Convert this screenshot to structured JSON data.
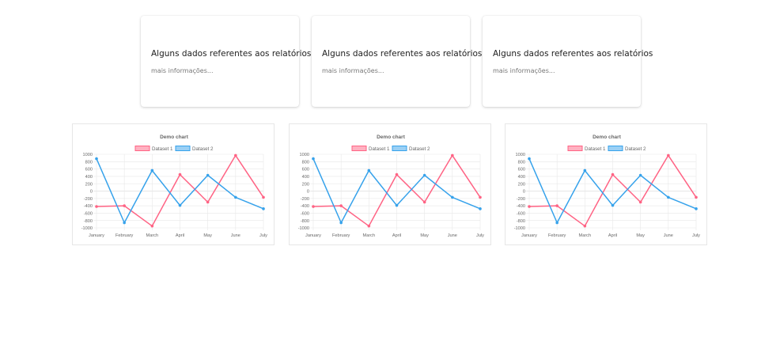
{
  "cards": [
    {
      "title": "Alguns dados referentes aos relatórios",
      "subtitle": "mais informações..."
    },
    {
      "title": "Alguns dados referentes aos relatórios",
      "subtitle": "mais informações..."
    },
    {
      "title": "Alguns dados referentes aos relatórios",
      "subtitle": "mais informações..."
    }
  ],
  "colors": {
    "dataset1": "#ff6384",
    "dataset2": "#36a2eb",
    "grid": "#e8e8e8",
    "text": "#666666"
  },
  "chart_data": [
    {
      "type": "line",
      "title": "Demo chart",
      "categories": [
        "January",
        "February",
        "March",
        "April",
        "May",
        "June",
        "July"
      ],
      "series": [
        {
          "name": "Dataset 1",
          "values": [
            -420,
            -400,
            -950,
            450,
            -300,
            970,
            -170
          ]
        },
        {
          "name": "Dataset 2",
          "values": [
            880,
            -860,
            560,
            -390,
            430,
            -170,
            -480
          ]
        }
      ],
      "yticks": [
        1000,
        800,
        600,
        400,
        200,
        0,
        -200,
        -400,
        -600,
        -800,
        -1000
      ],
      "ylim": [
        -1000,
        1000
      ],
      "grid": true,
      "legend": "top"
    },
    {
      "type": "line",
      "title": "Demo chart",
      "categories": [
        "January",
        "February",
        "March",
        "April",
        "May",
        "June",
        "July"
      ],
      "series": [
        {
          "name": "Dataset 1",
          "values": [
            -420,
            -400,
            -950,
            450,
            -300,
            970,
            -170
          ]
        },
        {
          "name": "Dataset 2",
          "values": [
            880,
            -860,
            560,
            -390,
            430,
            -170,
            -480
          ]
        }
      ],
      "yticks": [
        1000,
        800,
        600,
        400,
        200,
        0,
        -200,
        -400,
        -600,
        -800,
        -1000
      ],
      "ylim": [
        -1000,
        1000
      ],
      "grid": true,
      "legend": "top"
    },
    {
      "type": "line",
      "title": "Demo chart",
      "categories": [
        "January",
        "February",
        "March",
        "April",
        "May",
        "June",
        "July"
      ],
      "series": [
        {
          "name": "Dataset 1",
          "values": [
            -420,
            -400,
            -950,
            450,
            -300,
            970,
            -170
          ]
        },
        {
          "name": "Dataset 2",
          "values": [
            880,
            -860,
            560,
            -390,
            430,
            -170,
            -480
          ]
        }
      ],
      "yticks": [
        1000,
        800,
        600,
        400,
        200,
        0,
        -200,
        -400,
        -600,
        -800,
        -1000
      ],
      "ylim": [
        -1000,
        1000
      ],
      "grid": true,
      "legend": "top"
    }
  ]
}
